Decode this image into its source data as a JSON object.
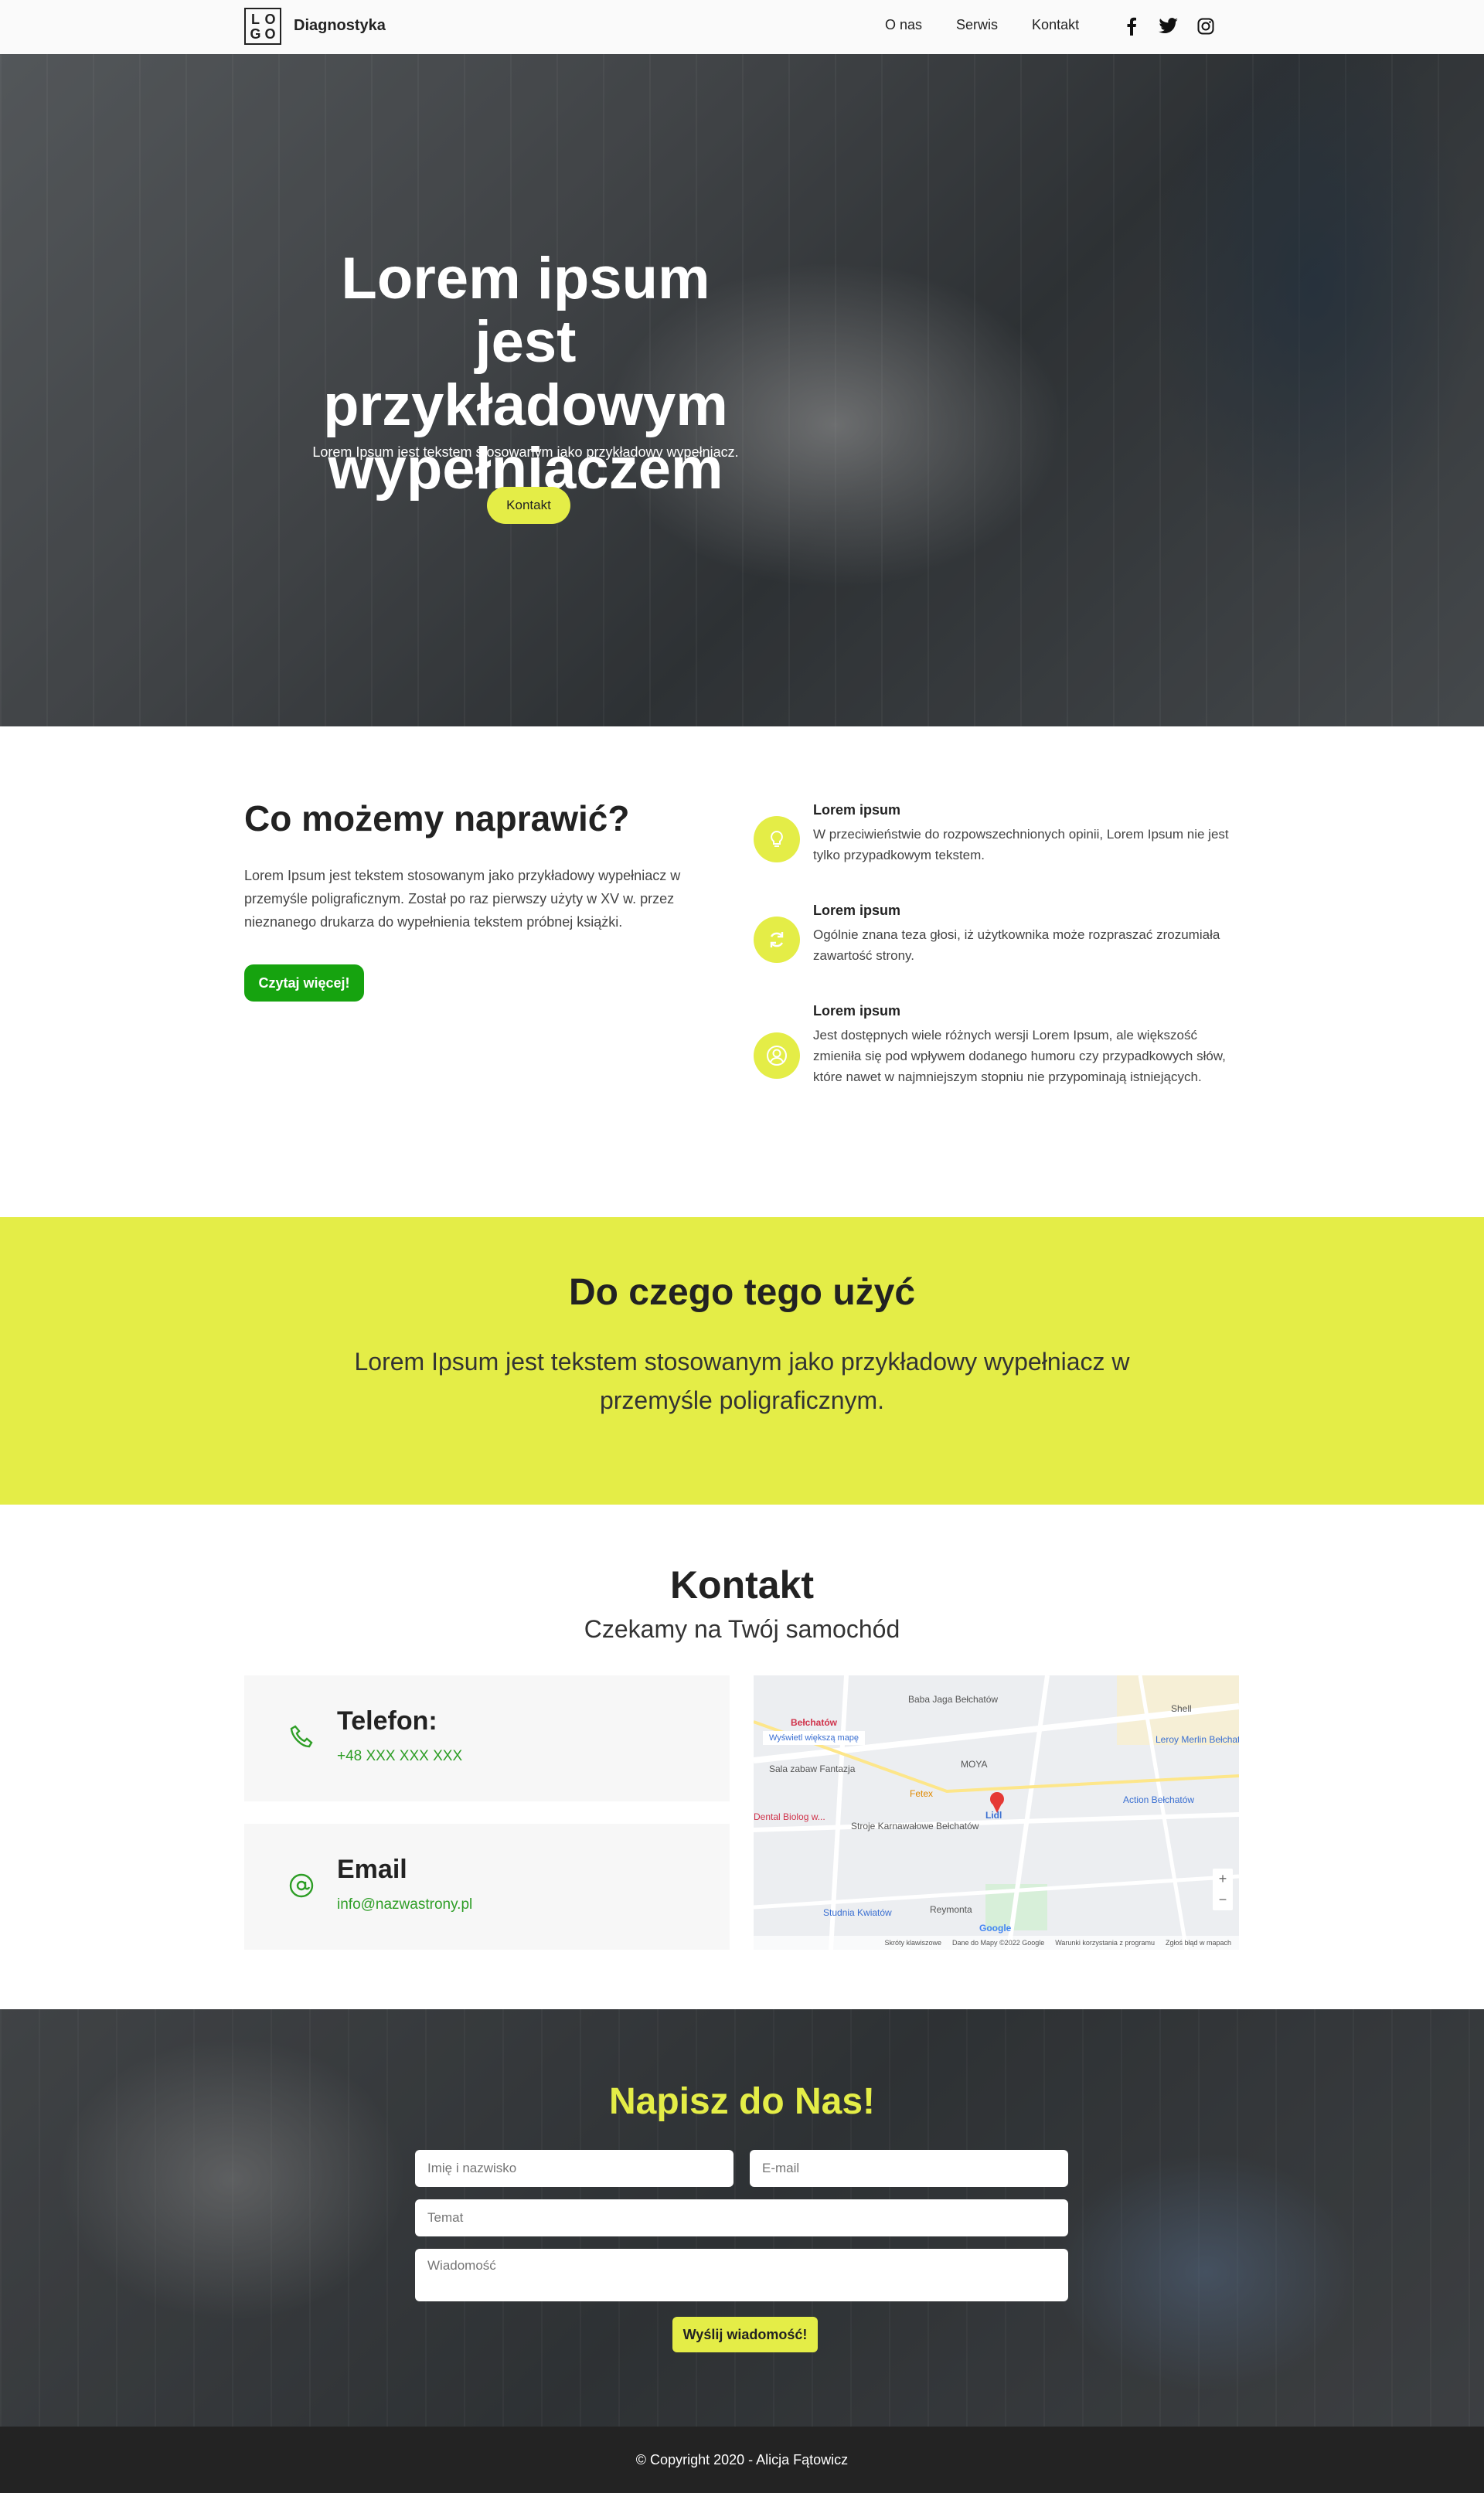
{
  "nav": {
    "logo_letters": [
      "L",
      "O",
      "G",
      "O"
    ],
    "brand": "Diagnostyka",
    "links": [
      "O nas",
      "Serwis",
      "Kontakt"
    ],
    "social_icons": [
      "facebook-icon",
      "twitter-icon",
      "instagram-icon"
    ]
  },
  "hero": {
    "title": "Lorem ipsum jest przykładowym wypełniaczem",
    "subtitle": "Lorem Ipsum jest tekstem stosowanym jako przykładowy wypełniacz.",
    "button": "Kontakt"
  },
  "services": {
    "title": "Co możemy naprawić?",
    "text": "Lorem Ipsum jest tekstem stosowanym jako przykładowy wypełniacz w przemyśle poligraficznym. Został po raz pierwszy użyty w XV w. przez nieznanego drukarza do wypełnienia tekstem próbnej książki.",
    "button": "Czytaj więcej!",
    "features": [
      {
        "icon": "lightbulb-icon",
        "title": "Lorem ipsum",
        "text": "W przeciwieństwie do rozpowszechnionych opinii, Lorem Ipsum nie jest tylko przypadkowym tekstem."
      },
      {
        "icon": "refresh-icon",
        "title": "Lorem ipsum",
        "text": "Ogólnie znana teza głosi, iż użytkownika może rozpraszać zrozumiała zawartość strony."
      },
      {
        "icon": "user-circle-icon",
        "title": "Lorem ipsum",
        "text": "Jest dostępnych wiele różnych wersji Lorem Ipsum, ale większość zmieniła się pod wpływem dodanego humoru czy przypadkowych słów, które nawet w najmniejszym stopniu nie przypominają istniejących."
      }
    ]
  },
  "band": {
    "title": "Do czego tego użyć",
    "text": "Lorem Ipsum jest tekstem stosowanym jako przykładowy wypełniacz w przemyśle poligraficznym."
  },
  "contact": {
    "title": "Kontakt",
    "subtitle": "Czekamy na Twój samochód",
    "phone_title": "Telefon:",
    "phone_value": "+48 XXX XXX XXX",
    "email_title": "Email",
    "email_value": "info@nazwastrony.pl",
    "map": {
      "link": "Wyświetl większą mapę",
      "labels": [
        "Bełchatów",
        "Baba Jaga Bełchatów",
        "Shell",
        "Leroy Merlin Bełchatów",
        "Sala zabaw Fantazja",
        "MOYA",
        "Action Bełchatów",
        "Fetex",
        "Lidl",
        "Dental Biolog w...",
        "Stroje Karnawałowe Bełchatów",
        "Studnia Kwiatów",
        "Reymonta",
        "Google"
      ],
      "footer": [
        "Skróty klawiszowe",
        "Dane do Mapy ©2022 Google",
        "Warunki korzystania z programu",
        "Zgłoś błąd w mapach"
      ]
    }
  },
  "form": {
    "title": "Napisz do Nas!",
    "name_placeholder": "Imię i nazwisko",
    "email_placeholder": "E-mail",
    "subject_placeholder": "Temat",
    "message_placeholder": "Wiadomość",
    "button": "Wyślij wiadomość!"
  },
  "footer": {
    "copyright": "© Copyright 2020 - Alicja Fątowicz"
  },
  "colors": {
    "accent_yellow": "#e4ed47",
    "accent_green": "#16a30f",
    "footer_bg": "#232323"
  }
}
